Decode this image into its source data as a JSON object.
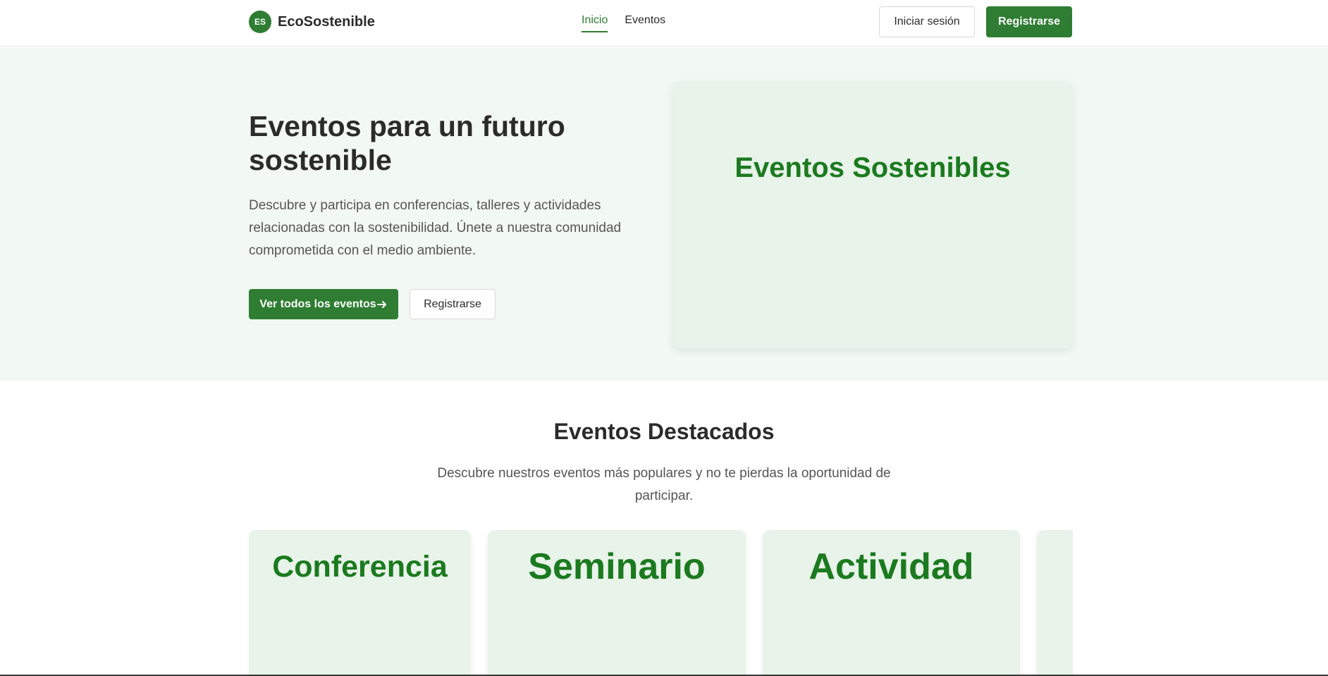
{
  "brand": {
    "badge": "ES",
    "name": "EcoSostenible",
    "primary_color": "#2e7d32",
    "accent_text_color": "#1b7a1f"
  },
  "nav": {
    "items": [
      {
        "label": "Inicio",
        "active": true
      },
      {
        "label": "Eventos",
        "active": false
      }
    ]
  },
  "header": {
    "login_label": "Iniciar sesión",
    "register_label": "Registrarse"
  },
  "hero": {
    "title": "Eventos para un futuro sostenible",
    "description": "Descubre y participa en conferencias, talleres y actividades relacionadas con la sostenibilidad. Únete a nuestra comunidad comprometida con el medio ambiente.",
    "primary_button": "Ver todos los eventos",
    "primary_button_icon": "arrow-right-icon",
    "secondary_button": "Registrarse",
    "card_text": "Eventos Sostenibles"
  },
  "featured": {
    "title": "Eventos Destacados",
    "description": "Descubre nuestros eventos más populares y no te pierdas la oportunidad de participar.",
    "cards": [
      {
        "label": "Conferencia"
      },
      {
        "label": "Seminario"
      },
      {
        "label": "Actividad"
      },
      {
        "label": ""
      }
    ]
  }
}
